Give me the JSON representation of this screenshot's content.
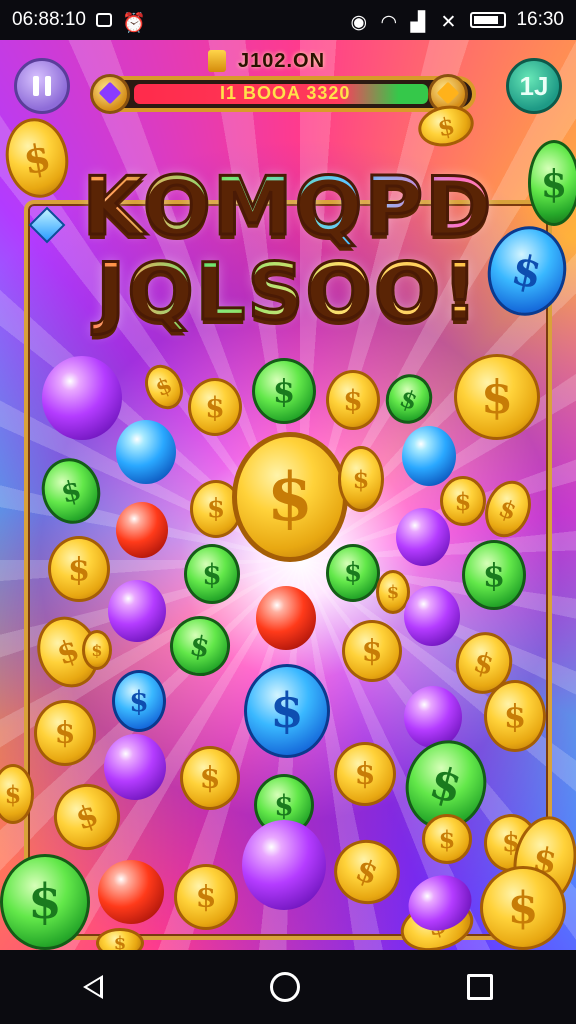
{
  "status_bar": {
    "time": "06:88:10",
    "right_time": "16:30",
    "icons": [
      "gallery-icon",
      "alarm-icon",
      "location-icon",
      "wifi-icon",
      "signal-icon",
      "no-sim-icon",
      "battery-icon"
    ]
  },
  "hud": {
    "score_label": "J102.ON",
    "progress_text": "I1 BOOA 3320",
    "progress_fraction": 0.88,
    "level_button": "1J",
    "pause_button_icon": "pause-icon"
  },
  "title": {
    "line1": "KOMQPD",
    "line2": "JQLSOO!"
  },
  "coins": {
    "symbol": "$"
  },
  "colors": {
    "frame": "#d9a23a",
    "progress_fill": "#ff2b4b",
    "progress_text": "#ffe14a"
  },
  "nav_bar": {
    "icons": [
      "back-icon",
      "home-icon",
      "recent-apps-icon"
    ]
  }
}
